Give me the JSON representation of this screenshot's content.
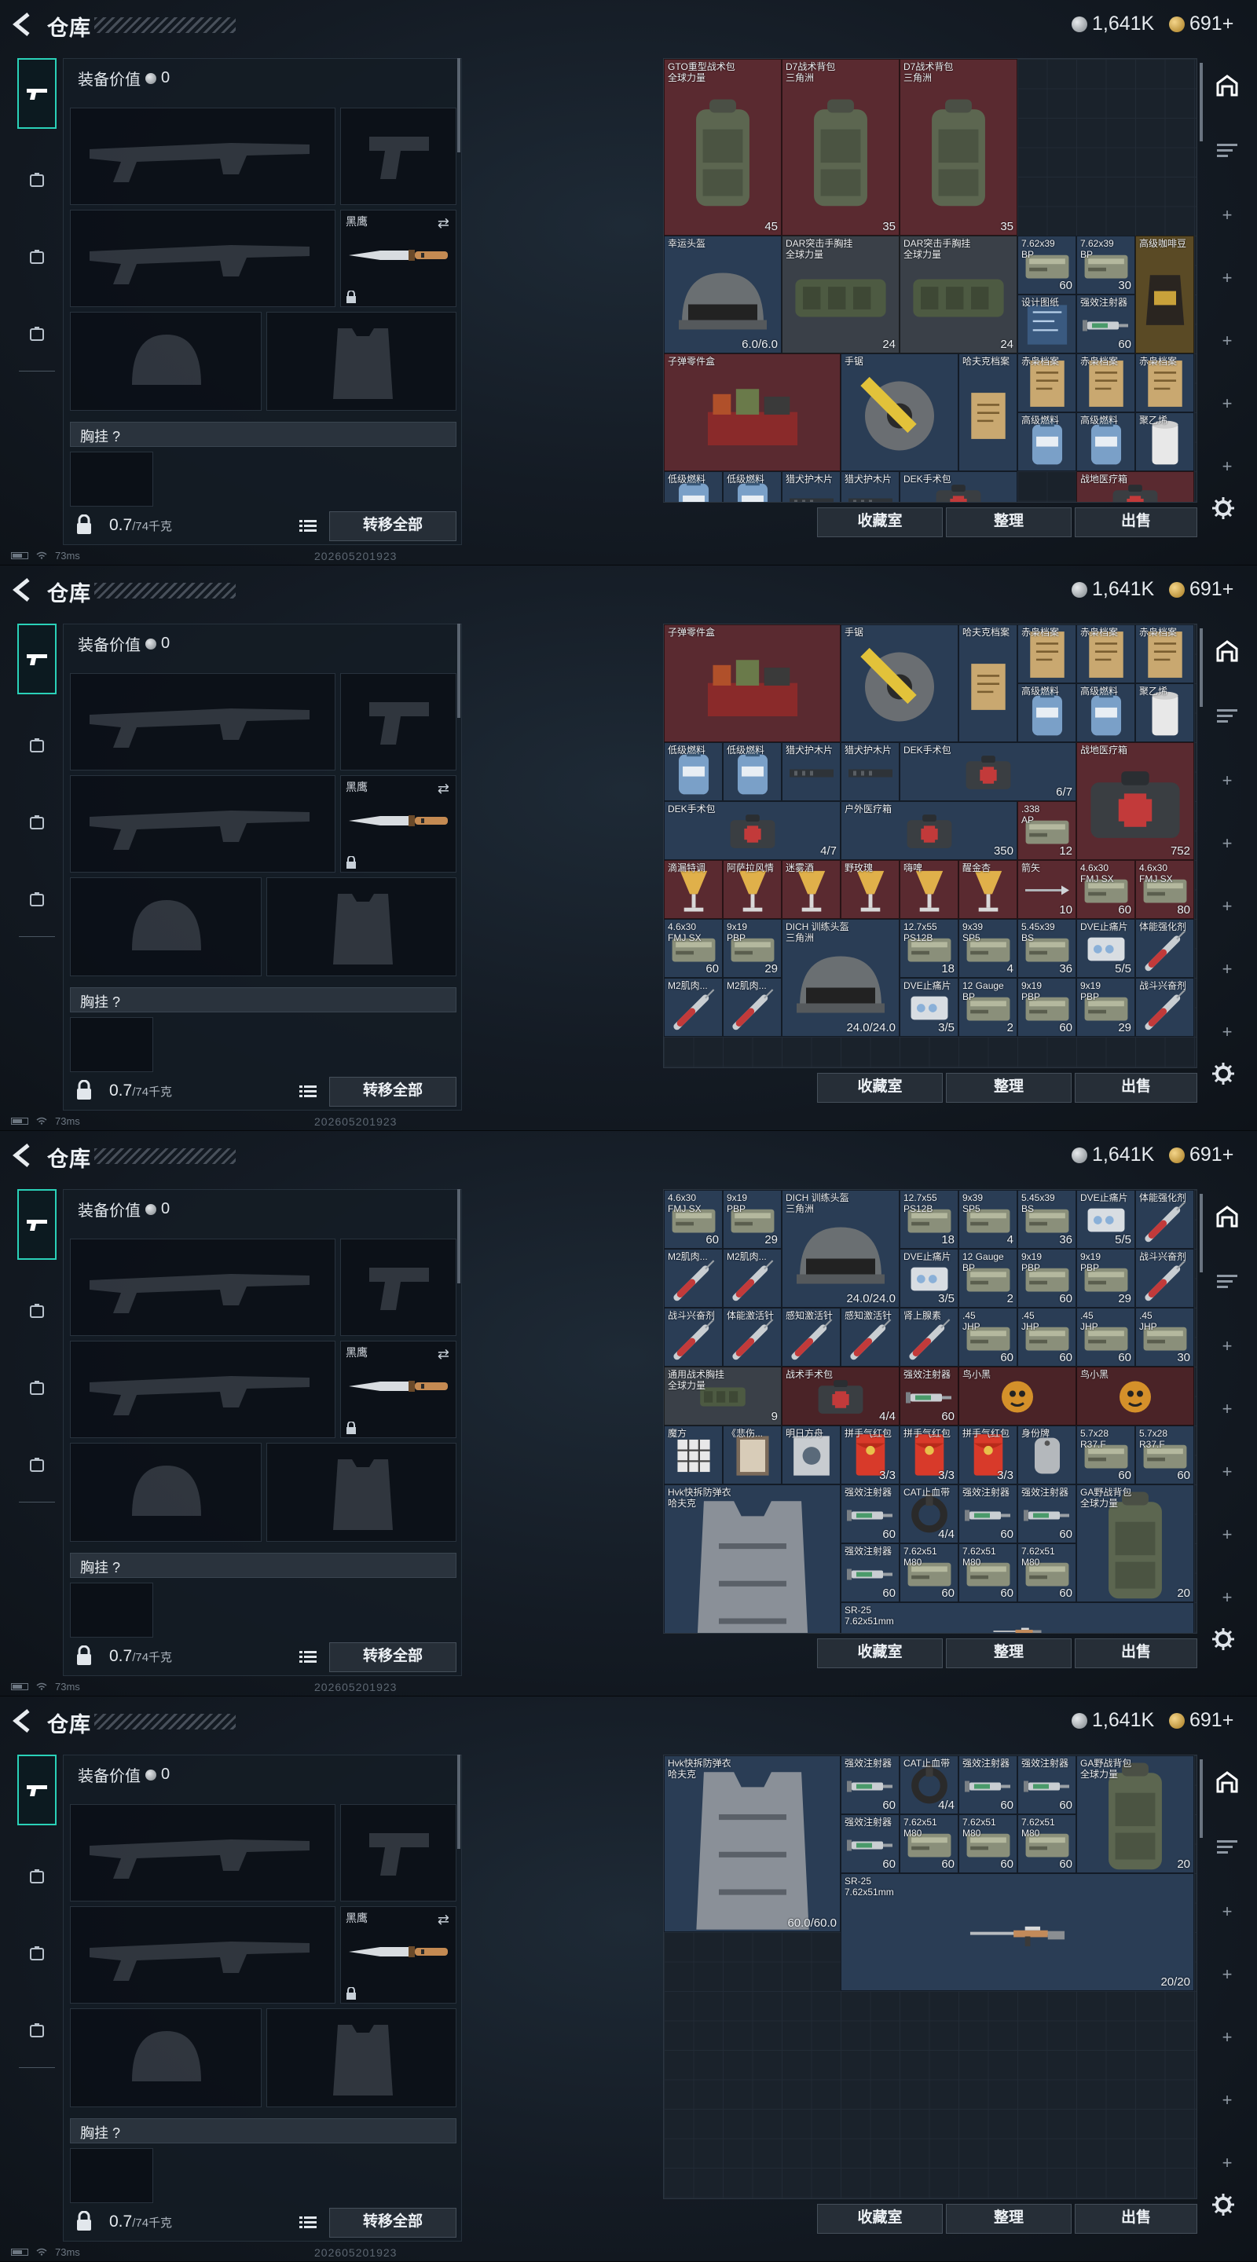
{
  "frames": [
    {
      "title": "仓库",
      "currency": {
        "silver": "1,641K",
        "gold": "691+"
      },
      "equip_value_label": "装备价值",
      "equip_value": "0",
      "knife_label": "黑鹰",
      "chest_label": "胸挂 ?",
      "weight": "0.7",
      "weight_max": "/74千克",
      "transfer_all": "转移全部",
      "btn_collection": "收藏室",
      "btn_sort": "整理",
      "btn_sell": "出售",
      "ping": "73ms",
      "build": "202605201923"
    },
    {
      "title": "仓库",
      "currency": {
        "silver": "1,641K",
        "gold": "691+"
      },
      "equip_value_label": "装备价值",
      "equip_value": "0",
      "knife_label": "黑鹰",
      "chest_label": "胸挂 ?",
      "weight": "0.7",
      "weight_max": "/74千克",
      "transfer_all": "转移全部",
      "btn_collection": "收藏室",
      "btn_sort": "整理",
      "btn_sell": "出售",
      "ping": "73ms",
      "build": "202605201923"
    },
    {
      "title": "仓库",
      "currency": {
        "silver": "1,641K",
        "gold": "691+"
      },
      "equip_value_label": "装备价值",
      "equip_value": "0",
      "knife_label": "黑鹰",
      "chest_label": "胸挂 ?",
      "weight": "0.7",
      "weight_max": "/74千克",
      "transfer_all": "转移全部",
      "btn_collection": "收藏室",
      "btn_sort": "整理",
      "btn_sell": "出售",
      "ping": "73ms",
      "build": "202605201923"
    },
    {
      "title": "仓库",
      "currency": {
        "silver": "1,641K",
        "gold": "691+"
      },
      "equip_value_label": "装备价值",
      "equip_value": "0",
      "knife_label": "黑鹰",
      "chest_label": "胸挂 ?",
      "weight": "0.7",
      "weight_max": "/74千克",
      "transfer_all": "转移全部",
      "btn_collection": "收藏室",
      "btn_sort": "整理",
      "btn_sell": "出售",
      "ping": "73ms",
      "build": "202605201923"
    }
  ],
  "stash_frame1": [
    {
      "name": "GTO重型战术包\n全球力量",
      "qty": "45",
      "color": "red",
      "icon": "backpack-icon"
    },
    {
      "name": "D7战术背包\n三角洲",
      "qty": "35",
      "color": "red",
      "icon": "backpack-icon"
    },
    {
      "name": "D7战术背包\n三角洲",
      "qty": "35",
      "color": "red",
      "icon": "backpack-icon"
    },
    {
      "name": "幸运头盔",
      "qty": "6.0/6.0",
      "color": "blue",
      "icon": "helmet-icon"
    },
    {
      "name": "DAR突击手胸挂\n全球力量",
      "qty": "24",
      "color": "gray",
      "icon": "chest-rig-icon"
    },
    {
      "name": "DAR突击手胸挂\n全球力量",
      "qty": "24",
      "color": "gray",
      "icon": "chest-rig-icon"
    },
    {
      "name": "7.62x39\nBP",
      "qty": "60",
      "color": "blue",
      "icon": "ammo-icon"
    },
    {
      "name": "7.62x39\nBP",
      "qty": "30",
      "color": "blue",
      "icon": "ammo-icon"
    },
    {
      "name": "高级咖啡豆",
      "qty": "",
      "color": "gold",
      "icon": "coffee-icon"
    },
    {
      "name": "设计图纸",
      "qty": "",
      "color": "blue",
      "icon": "blueprint-icon"
    },
    {
      "name": "强效注射器",
      "qty": "60",
      "color": "blue",
      "icon": "syringe-icon"
    },
    {
      "name": "子弹零件盒",
      "qty": "",
      "color": "red",
      "icon": "parts-box-icon"
    },
    {
      "name": "手锯",
      "qty": "",
      "color": "blue",
      "icon": "saw-icon"
    },
    {
      "name": "哈夫克档案",
      "qty": "",
      "color": "blue",
      "icon": "file-icon"
    },
    {
      "name": "赤枭档案",
      "qty": "",
      "color": "blue",
      "icon": "file-icon"
    },
    {
      "name": "赤枭档案",
      "qty": "",
      "color": "blue",
      "icon": "file-icon"
    },
    {
      "name": "赤枭档案",
      "qty": "",
      "color": "blue",
      "icon": "file-icon"
    },
    {
      "name": "高级燃料",
      "qty": "",
      "color": "blue",
      "icon": "fuel-icon"
    },
    {
      "name": "高级燃料",
      "qty": "",
      "color": "blue",
      "icon": "fuel-icon"
    },
    {
      "name": "聚乙烯",
      "qty": "",
      "color": "blue",
      "icon": "roll-icon"
    },
    {
      "name": "低级燃料",
      "qty": "",
      "color": "blue",
      "icon": "fuel-icon"
    },
    {
      "name": "低级燃料",
      "qty": "",
      "color": "blue",
      "icon": "fuel-icon"
    },
    {
      "name": "猎犬护木片",
      "qty": "",
      "color": "blue",
      "icon": "part-icon"
    },
    {
      "name": "猎犬护木片",
      "qty": "",
      "color": "blue",
      "icon": "part-icon"
    },
    {
      "name": "DEK手术包",
      "qty": "",
      "color": "blue",
      "icon": "medkit-icon"
    },
    {
      "name": "战地医疗箱",
      "qty": "",
      "color": "red",
      "icon": "medkit-icon"
    }
  ],
  "stash_frame2": [
    {
      "name": "子弹零件盒",
      "qty": "",
      "color": "red",
      "icon": "parts-box-icon"
    },
    {
      "name": "手锯",
      "qty": "",
      "color": "blue",
      "icon": "saw-icon"
    },
    {
      "name": "哈夫克档案",
      "qty": "",
      "color": "blue",
      "icon": "file-icon"
    },
    {
      "name": "赤枭档案",
      "qty": "",
      "color": "blue",
      "icon": "file-icon"
    },
    {
      "name": "赤枭档案",
      "qty": "",
      "color": "blue",
      "icon": "file-icon"
    },
    {
      "name": "赤枭档案",
      "qty": "",
      "color": "blue",
      "icon": "file-icon"
    },
    {
      "name": "高级燃料",
      "qty": "",
      "color": "blue",
      "icon": "fuel-icon"
    },
    {
      "name": "高级燃料",
      "qty": "",
      "color": "blue",
      "icon": "fuel-icon"
    },
    {
      "name": "聚乙烯",
      "qty": "",
      "color": "blue",
      "icon": "roll-icon"
    },
    {
      "name": "低级燃料",
      "qty": "",
      "color": "blue",
      "icon": "fuel-icon"
    },
    {
      "name": "低级燃料",
      "qty": "",
      "color": "blue",
      "icon": "fuel-icon"
    },
    {
      "name": "猎犬护木片",
      "qty": "",
      "color": "blue",
      "icon": "part-icon"
    },
    {
      "name": "猎犬护木片",
      "qty": "",
      "color": "blue",
      "icon": "part-icon"
    },
    {
      "name": "DEK手术包",
      "qty": "6/7",
      "color": "blue",
      "icon": "medkit-icon"
    },
    {
      "name": "战地医疗箱",
      "qty": "752",
      "color": "red",
      "icon": "medkit-icon"
    },
    {
      "name": "DEK手术包",
      "qty": "4/7",
      "color": "blue",
      "icon": "medkit-icon"
    },
    {
      "name": "户外医疗箱",
      "qty": "350",
      "color": "blue",
      "icon": "medkit-icon"
    },
    {
      "name": ".338\nAP",
      "qty": "12",
      "color": "red",
      "icon": "ammo-icon"
    },
    {
      "name": "滴漏特调",
      "qty": "",
      "color": "red",
      "icon": "drink-icon"
    },
    {
      "name": "阿萨拉风情",
      "qty": "",
      "color": "red",
      "icon": "drink-icon"
    },
    {
      "name": "迷雾酒",
      "qty": "",
      "color": "red",
      "icon": "drink-icon"
    },
    {
      "name": "野玫瑰",
      "qty": "",
      "color": "red",
      "icon": "drink-icon"
    },
    {
      "name": "嗨啤",
      "qty": "",
      "color": "red",
      "icon": "drink-icon"
    },
    {
      "name": "醒金杏",
      "qty": "",
      "color": "red",
      "icon": "drink-icon"
    },
    {
      "name": "箭矢",
      "qty": "10",
      "color": "red",
      "icon": "arrow-icon"
    },
    {
      "name": "4.6x30\nFMJ SX",
      "qty": "60",
      "color": "red",
      "icon": "ammo-icon"
    },
    {
      "name": "4.6x30\nFMJ SX",
      "qty": "80",
      "color": "red",
      "icon": "ammo-icon"
    },
    {
      "name": "4.6x30\nFMJ SX",
      "qty": "60",
      "color": "blue",
      "icon": "ammo-icon"
    },
    {
      "name": "9x19\nPBP",
      "qty": "29",
      "color": "blue",
      "icon": "ammo-icon"
    },
    {
      "name": "DICH 训练头盔\n三角洲",
      "qty": "24.0/24.0",
      "color": "blue",
      "icon": "helmet-icon"
    },
    {
      "name": "12.7x55\nPS12B",
      "qty": "18",
      "color": "blue",
      "icon": "ammo-icon"
    },
    {
      "name": "9x39\nSP5",
      "qty": "4",
      "color": "blue",
      "icon": "ammo-icon"
    },
    {
      "name": "5.45x39\nBS",
      "qty": "36",
      "color": "blue",
      "icon": "ammo-icon"
    },
    {
      "name": "DVE止痛片",
      "qty": "5/5",
      "color": "blue",
      "icon": "pills-icon"
    },
    {
      "name": "体能强化剂",
      "qty": "",
      "color": "blue",
      "icon": "injector-icon"
    },
    {
      "name": "M2肌肉...",
      "qty": "",
      "color": "blue",
      "icon": "injector-icon"
    },
    {
      "name": "M2肌肉...",
      "qty": "",
      "color": "blue",
      "icon": "injector-icon"
    },
    {
      "name": "DVE止痛片",
      "qty": "3/5",
      "color": "blue",
      "icon": "pills-icon"
    },
    {
      "name": "12 Gauge\nBP",
      "qty": "2",
      "color": "blue",
      "icon": "ammo-icon"
    },
    {
      "name": "9x19\nPBP",
      "qty": "60",
      "color": "blue",
      "icon": "ammo-icon"
    },
    {
      "name": "9x19\nPBP",
      "qty": "29",
      "color": "blue",
      "icon": "ammo-icon"
    },
    {
      "name": "战斗兴奋剂",
      "qty": "",
      "color": "blue",
      "icon": "injector-icon"
    }
  ],
  "stash_frame3": [
    {
      "name": "4.6x30\nFMJ SX",
      "qty": "60",
      "color": "blue",
      "icon": "ammo-icon"
    },
    {
      "name": "9x19\nPBP",
      "qty": "29",
      "color": "blue",
      "icon": "ammo-icon"
    },
    {
      "name": "DICH 训练头盔\n三角洲",
      "qty": "24.0/24.0",
      "color": "blue",
      "icon": "helmet-icon"
    },
    {
      "name": "12.7x55\nPS12B",
      "qty": "18",
      "color": "blue",
      "icon": "ammo-icon"
    },
    {
      "name": "9x39\nSP5",
      "qty": "4",
      "color": "blue",
      "icon": "ammo-icon"
    },
    {
      "name": "5.45x39\nBS",
      "qty": "36",
      "color": "blue",
      "icon": "ammo-icon"
    },
    {
      "name": "DVE止痛片",
      "qty": "5/5",
      "color": "blue",
      "icon": "pills-icon"
    },
    {
      "name": "体能强化剂",
      "qty": "",
      "color": "blue",
      "icon": "injector-icon"
    },
    {
      "name": "M2肌肉...",
      "qty": "",
      "color": "blue",
      "icon": "injector-icon"
    },
    {
      "name": "M2肌肉...",
      "qty": "",
      "color": "blue",
      "icon": "injector-icon"
    },
    {
      "name": "DVE止痛片",
      "qty": "3/5",
      "color": "blue",
      "icon": "pills-icon"
    },
    {
      "name": "12 Gauge\nBP",
      "qty": "2",
      "color": "blue",
      "icon": "ammo-icon"
    },
    {
      "name": "9x19\nPBP",
      "qty": "60",
      "color": "blue",
      "icon": "ammo-icon"
    },
    {
      "name": "9x19\nPBP",
      "qty": "29",
      "color": "blue",
      "icon": "ammo-icon"
    },
    {
      "name": "战斗兴奋剂",
      "qty": "",
      "color": "blue",
      "icon": "injector-icon"
    },
    {
      "name": "战斗兴奋剂",
      "qty": "",
      "color": "blue",
      "icon": "injector-icon"
    },
    {
      "name": "体能激活针",
      "qty": "",
      "color": "blue",
      "icon": "injector-icon"
    },
    {
      "name": "感知激活针",
      "qty": "",
      "color": "blue",
      "icon": "injector-icon"
    },
    {
      "name": "感知激活针",
      "qty": "",
      "color": "blue",
      "icon": "injector-icon"
    },
    {
      "name": "肾上腺素",
      "qty": "",
      "color": "blue",
      "icon": "injector-icon"
    },
    {
      "name": ".45\nJHP",
      "qty": "60",
      "color": "blue",
      "icon": "ammo-icon"
    },
    {
      "name": ".45\nJHP",
      "qty": "60",
      "color": "blue",
      "icon": "ammo-icon"
    },
    {
      "name": ".45\nJHP",
      "qty": "60",
      "color": "blue",
      "icon": "ammo-icon"
    },
    {
      "name": ".45\nJHP",
      "qty": "30",
      "color": "blue",
      "icon": "ammo-icon"
    },
    {
      "name": "通用战术胸挂\n全球力量",
      "qty": "9",
      "color": "gray",
      "icon": "chest-rig-icon"
    },
    {
      "name": "战术手术包",
      "qty": "4/4",
      "color": "dred",
      "icon": "medkit-icon"
    },
    {
      "name": "强效注射器",
      "qty": "60",
      "color": "dred",
      "icon": "syringe-icon"
    },
    {
      "name": "鸟小黑",
      "qty": "",
      "color": "dred",
      "icon": "trinket-icon"
    },
    {
      "name": "鸟小黑",
      "qty": "",
      "color": "dred",
      "icon": "trinket-icon"
    },
    {
      "name": "魔方",
      "qty": "",
      "color": "blue",
      "icon": "cube-icon"
    },
    {
      "name": "《悲伤...",
      "qty": "",
      "color": "blue",
      "icon": "book-icon"
    },
    {
      "name": "明日方舟",
      "qty": "",
      "color": "blue",
      "icon": "card-icon"
    },
    {
      "name": "拼手气红包",
      "qty": "3/3",
      "color": "blue",
      "icon": "red-envelope-icon"
    },
    {
      "name": "拼手气红包",
      "qty": "3/3",
      "color": "blue",
      "icon": "red-envelope-icon"
    },
    {
      "name": "拼手气红包",
      "qty": "3/3",
      "color": "blue",
      "icon": "red-envelope-icon"
    },
    {
      "name": "身份牌",
      "qty": "",
      "color": "blue",
      "icon": "dogtag-icon"
    },
    {
      "name": "5.7x28\nR37.F",
      "qty": "60",
      "color": "blue",
      "icon": "ammo-icon"
    },
    {
      "name": "5.7x28\nR37.F",
      "qty": "60",
      "color": "blue",
      "icon": "ammo-icon"
    },
    {
      "name": "Hvk快拆防弹衣\n哈夫克",
      "qty": "",
      "color": "blue",
      "icon": "vest-icon"
    },
    {
      "name": "强效注射器",
      "qty": "60",
      "color": "blue",
      "icon": "syringe-icon"
    },
    {
      "name": "CAT止血带",
      "qty": "4/4",
      "color": "blue",
      "icon": "tourniquet-icon"
    },
    {
      "name": "强效注射器",
      "qty": "60",
      "color": "blue",
      "icon": "syringe-icon"
    },
    {
      "name": "强效注射器",
      "qty": "60",
      "color": "blue",
      "icon": "syringe-icon"
    },
    {
      "name": "GA野战背包\n全球力量",
      "qty": "20",
      "color": "blue",
      "icon": "backpack-icon"
    },
    {
      "name": "强效注射器",
      "qty": "60",
      "color": "blue",
      "icon": "syringe-icon"
    },
    {
      "name": "7.62x51\nM80",
      "qty": "60",
      "color": "blue",
      "icon": "ammo-icon"
    },
    {
      "name": "7.62x51\nM80",
      "qty": "60",
      "color": "blue",
      "icon": "ammo-icon"
    },
    {
      "name": "7.62x51\nM80",
      "qty": "60",
      "color": "blue",
      "icon": "ammo-icon"
    },
    {
      "name": "SR-25\n7.62x51mm",
      "qty": "",
      "color": "blue",
      "icon": "rifle-icon"
    }
  ],
  "stash_frame4": [
    {
      "name": "Hvk快拆防弹衣\n哈夫克",
      "qty": "60.0/60.0",
      "color": "blue",
      "icon": "vest-icon"
    },
    {
      "name": "强效注射器",
      "qty": "60",
      "color": "blue",
      "icon": "syringe-icon"
    },
    {
      "name": "CAT止血带",
      "qty": "4/4",
      "color": "blue",
      "icon": "tourniquet-icon"
    },
    {
      "name": "强效注射器",
      "qty": "60",
      "color": "blue",
      "icon": "syringe-icon"
    },
    {
      "name": "强效注射器",
      "qty": "60",
      "color": "blue",
      "icon": "syringe-icon"
    },
    {
      "name": "GA野战背包\n全球力量",
      "qty": "20",
      "color": "blue",
      "icon": "backpack-icon"
    },
    {
      "name": "强效注射器",
      "qty": "60",
      "color": "blue",
      "icon": "syringe-icon"
    },
    {
      "name": "7.62x51\nM80",
      "qty": "60",
      "color": "blue",
      "icon": "ammo-icon"
    },
    {
      "name": "7.62x51\nM80",
      "qty": "60",
      "color": "blue",
      "icon": "ammo-icon"
    },
    {
      "name": "7.62x51\nM80",
      "qty": "60",
      "color": "blue",
      "icon": "ammo-icon"
    },
    {
      "name": "SR-25\n7.62x51mm",
      "qty": "20/20",
      "color": "blue",
      "icon": "rifle-icon"
    }
  ]
}
